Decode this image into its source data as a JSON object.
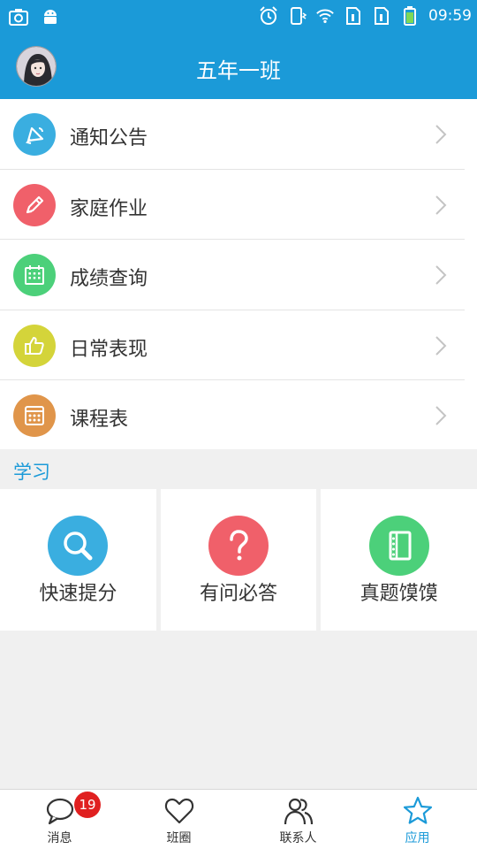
{
  "status_bar": {
    "time": "09:59",
    "left_icons": [
      "screenshot-icon",
      "android-icon"
    ],
    "right_icons": [
      "alarm-icon",
      "vibrate-icon",
      "wifi-icon",
      "sim1-icon",
      "sim2-icon",
      "battery-icon"
    ]
  },
  "header": {
    "title": "五年一班",
    "avatar": "user-avatar"
  },
  "menu": {
    "items": [
      {
        "label": "通知公告",
        "icon": "broadcast-icon",
        "color": "#3aaee0"
      },
      {
        "label": "家庭作业",
        "icon": "pencil-icon",
        "color": "#f0606a"
      },
      {
        "label": "成绩查询",
        "icon": "calendar-icon",
        "color": "#4cd07a"
      },
      {
        "label": "日常表现",
        "icon": "thumbs-up-icon",
        "color": "#d4d43a"
      },
      {
        "label": "课程表",
        "icon": "timetable-icon",
        "color": "#e0954a"
      }
    ]
  },
  "study": {
    "section_title": "学习",
    "items": [
      {
        "label": "快速提分",
        "icon": "search-icon",
        "color": "#3aaee0"
      },
      {
        "label": "有问必答",
        "icon": "question-icon",
        "color": "#f0606a"
      },
      {
        "label": "真题馍馍",
        "icon": "book-icon",
        "color": "#4cd07a"
      }
    ]
  },
  "bottom_nav": {
    "items": [
      {
        "label": "消息",
        "icon": "chat-bubble-icon",
        "badge": "19"
      },
      {
        "label": "班圈",
        "icon": "heart-icon"
      },
      {
        "label": "联系人",
        "icon": "contacts-icon"
      },
      {
        "label": "应用",
        "icon": "star-icon",
        "active": true
      }
    ]
  },
  "colors": {
    "primary": "#1b9ad8",
    "badge": "#e02020",
    "background": "#f0f0f0"
  }
}
